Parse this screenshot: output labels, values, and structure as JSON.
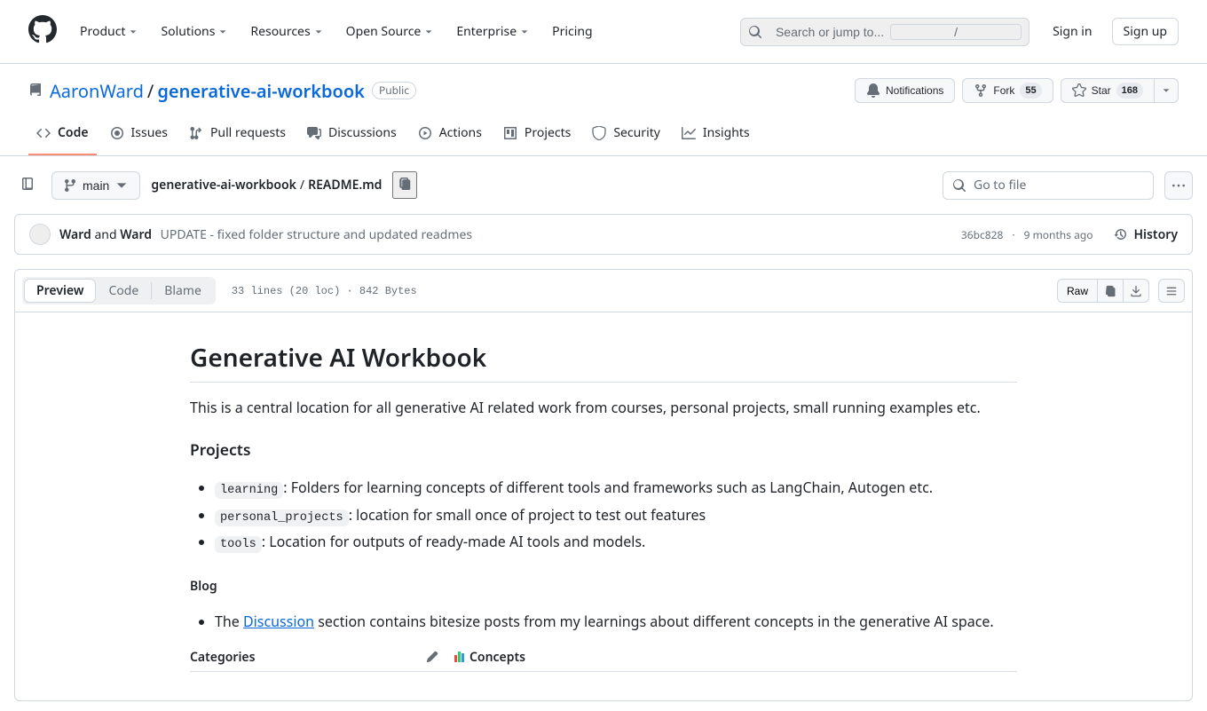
{
  "header": {
    "nav": [
      "Product",
      "Solutions",
      "Resources",
      "Open Source",
      "Enterprise",
      "Pricing"
    ],
    "nav_has_dropdown": [
      true,
      true,
      true,
      true,
      true,
      false
    ],
    "search_placeholder": "Search or jump to...",
    "slash": "/",
    "signin": "Sign in",
    "signup": "Sign up"
  },
  "repo": {
    "owner": "AaronWard",
    "name": "generative-ai-workbook",
    "visibility": "Public",
    "actions": {
      "notifications": "Notifications",
      "fork": "Fork",
      "fork_count": "55",
      "star": "Star",
      "star_count": "168"
    },
    "tabs": [
      "Code",
      "Issues",
      "Pull requests",
      "Discussions",
      "Actions",
      "Projects",
      "Security",
      "Insights"
    ]
  },
  "filebar": {
    "branch": "main",
    "crumb_root": "generative-ai-workbook",
    "crumb_file": "README.md",
    "goto_placeholder": "Go to file"
  },
  "commit": {
    "author1": "Ward",
    "and": " and ",
    "author2": "Ward",
    "message": "UPDATE - fixed folder structure and updated readmes",
    "sha": "36bc828",
    "sep": " · ",
    "time": "9 months ago",
    "history": "History"
  },
  "fileview": {
    "tabs": [
      "Preview",
      "Code",
      "Blame"
    ],
    "info": "33 lines (20 loc) · 842 Bytes",
    "raw": "Raw"
  },
  "readme": {
    "title": "Generative AI Workbook",
    "intro": "This is a central location for all generative AI related work from courses, personal projects, small running examples etc.",
    "h_projects": "Projects",
    "items": [
      {
        "code": "learning",
        "text": ": Folders for learning concepts of different tools and frameworks such as LangChain, Autogen etc."
      },
      {
        "code": "personal_projects",
        "text": ": location for small once of project to test out features"
      },
      {
        "code": "tools",
        "text": ": Location for outputs of ready-made AI tools and models."
      }
    ],
    "h_blog": "Blog",
    "blog_pre": "The ",
    "blog_link": "Discussion",
    "blog_post": " section contains bitesize posts from my learnings about different concepts in the generative AI space.",
    "table_cat": "Categories",
    "table_con": "Concepts"
  }
}
